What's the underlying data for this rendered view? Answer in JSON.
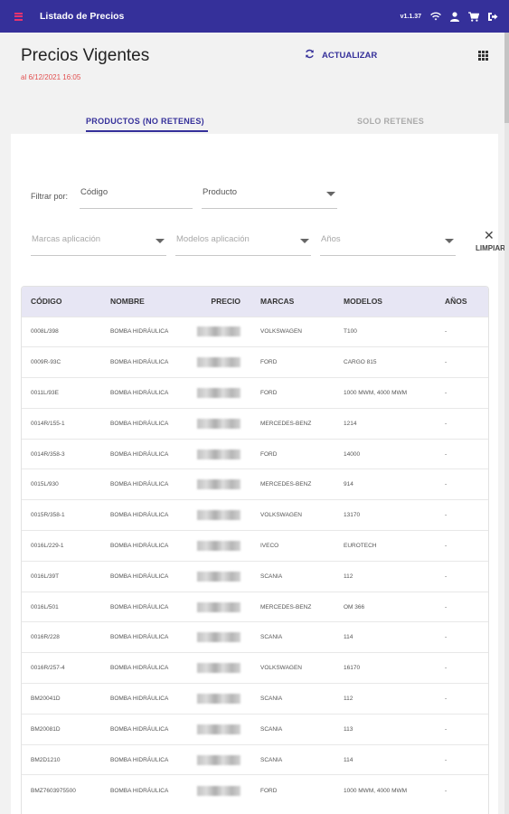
{
  "appbar": {
    "title": "Listado de Precios",
    "version": "v1.1.37",
    "icons": [
      "menu-icon",
      "wifi-icon",
      "user-icon",
      "cart-icon",
      "logout-icon"
    ]
  },
  "header": {
    "title": "Precios Vigentes",
    "timestamp": "al 6/12/2021 16:05",
    "refresh_label": "ACTUALIZAR"
  },
  "tabs": [
    {
      "label": "PRODUCTOS (NO RETENES)",
      "active": true
    },
    {
      "label": "SOLO RETENES",
      "active": false
    }
  ],
  "filters": {
    "label": "Filtrar por:",
    "codigo": "Código",
    "producto": "Producto",
    "marcas": "Marcas aplicación",
    "modelos": "Modelos aplicación",
    "anios": "Años",
    "clear_label": "LIMPIAR"
  },
  "table": {
    "columns": [
      "CÓDIGO",
      "NOMBRE",
      "PRECIO",
      "MARCAS",
      "MODELOS",
      "AÑOS"
    ],
    "rows": [
      [
        "0008L/398",
        "BOMBA HIDRÁULICA",
        "VOLKSWAGEN",
        "T100",
        "-"
      ],
      [
        "0009R-93C",
        "BOMBA HIDRÁULICA",
        "FORD",
        "CARGO 815",
        "-"
      ],
      [
        "0011L/93E",
        "BOMBA HIDRÁULICA",
        "FORD",
        "1000 MWM, 4000 MWM",
        "-"
      ],
      [
        "0014R/155-1",
        "BOMBA HIDRÁULICA",
        "MERCEDES-BENZ",
        "1214",
        "-"
      ],
      [
        "0014R/358-3",
        "BOMBA HIDRÁULICA",
        "FORD",
        "14000",
        "-"
      ],
      [
        "0015L/930",
        "BOMBA HIDRÁULICA",
        "MERCEDES-BENZ",
        "914",
        "-"
      ],
      [
        "0015R/358-1",
        "BOMBA HIDRÁULICA",
        "VOLKSWAGEN",
        "13170",
        "-"
      ],
      [
        "0016L/229-1",
        "BOMBA HIDRÁULICA",
        "IVECO",
        "EUROTECH",
        "-"
      ],
      [
        "0016L/39T",
        "BOMBA HIDRÁULICA",
        "SCANIA",
        "112",
        "-"
      ],
      [
        "0016L/501",
        "BOMBA HIDRÁULICA",
        "MERCEDES-BENZ",
        "OM 366",
        "-"
      ],
      [
        "0016R/228",
        "BOMBA HIDRÁULICA",
        "SCANIA",
        "114",
        "-"
      ],
      [
        "0016R/257-4",
        "BOMBA HIDRÁULICA",
        "VOLKSWAGEN",
        "16170",
        "-"
      ],
      [
        "BM20041D",
        "BOMBA HIDRÁULICA",
        "SCANIA",
        "112",
        "-"
      ],
      [
        "BM20081D",
        "BOMBA HIDRÁULICA",
        "SCANIA",
        "113",
        "-"
      ],
      [
        "BM2D1210",
        "BOMBA HIDRÁULICA",
        "SCANIA",
        "114",
        "-"
      ],
      [
        "BMZ7603975500",
        "BOMBA HIDRÁULICA",
        "FORD",
        "1000 MWM, 4000 MWM",
        "-"
      ]
    ]
  },
  "colors": {
    "primary": "#35309a",
    "accent": "#e8336e",
    "timestamp": "#e25050",
    "header_row": "#e7e6f4"
  }
}
